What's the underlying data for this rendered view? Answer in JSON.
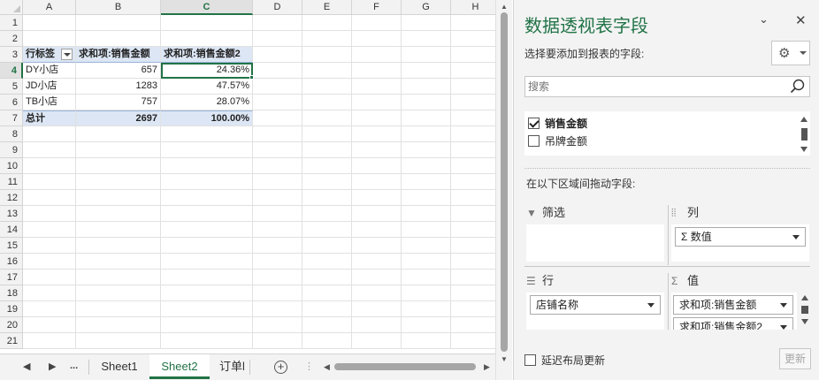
{
  "columns": [
    "A",
    "B",
    "C",
    "D",
    "E",
    "F",
    "G",
    "H"
  ],
  "rows": [
    "1",
    "2",
    "3",
    "4",
    "5",
    "6",
    "7",
    "8",
    "9",
    "10",
    "11",
    "12",
    "13",
    "14",
    "15",
    "16",
    "17",
    "18",
    "19",
    "20",
    "21"
  ],
  "pivot": {
    "header": {
      "label": "行标签",
      "sum1": "求和项:销售金额",
      "sum2": "求和项:销售金额2"
    },
    "rows": [
      {
        "label": "DY小店",
        "sum1": "657",
        "sum2": "24.36%"
      },
      {
        "label": "JD小店",
        "sum1": "1283",
        "sum2": "47.57%"
      },
      {
        "label": "TB小店",
        "sum1": "757",
        "sum2": "28.07%"
      }
    ],
    "total": {
      "label": "总计",
      "sum1": "2697",
      "sum2": "100.00%"
    }
  },
  "tabs": {
    "prev": "◀",
    "next": "▶",
    "more": "...",
    "items": [
      "Sheet1",
      "Sheet2",
      "订单l"
    ],
    "active": "Sheet2",
    "add": "+",
    "options": "⋮"
  },
  "pane": {
    "title": "数据透视表字段",
    "choose_label": "选择要添加到报表的字段:",
    "search_placeholder": "搜索",
    "fields": [
      {
        "label": "销售金额",
        "checked": true
      },
      {
        "label": "吊牌金额",
        "checked": false
      }
    ],
    "drag_label": "在以下区域间拖动字段:",
    "areas": {
      "filter": {
        "title": "筛选"
      },
      "columns": {
        "title": "列",
        "chips": [
          "Σ 数值"
        ]
      },
      "rows": {
        "title": "行",
        "chips": [
          "店铺名称"
        ]
      },
      "values": {
        "title": "值",
        "chips": [
          "求和项:销售金额",
          "求和项:销售金额2"
        ]
      }
    },
    "defer_label": "延迟布局更新",
    "update_label": "更新"
  },
  "colors": {
    "accent": "#217346",
    "pivot_header": "#dce6f4"
  }
}
